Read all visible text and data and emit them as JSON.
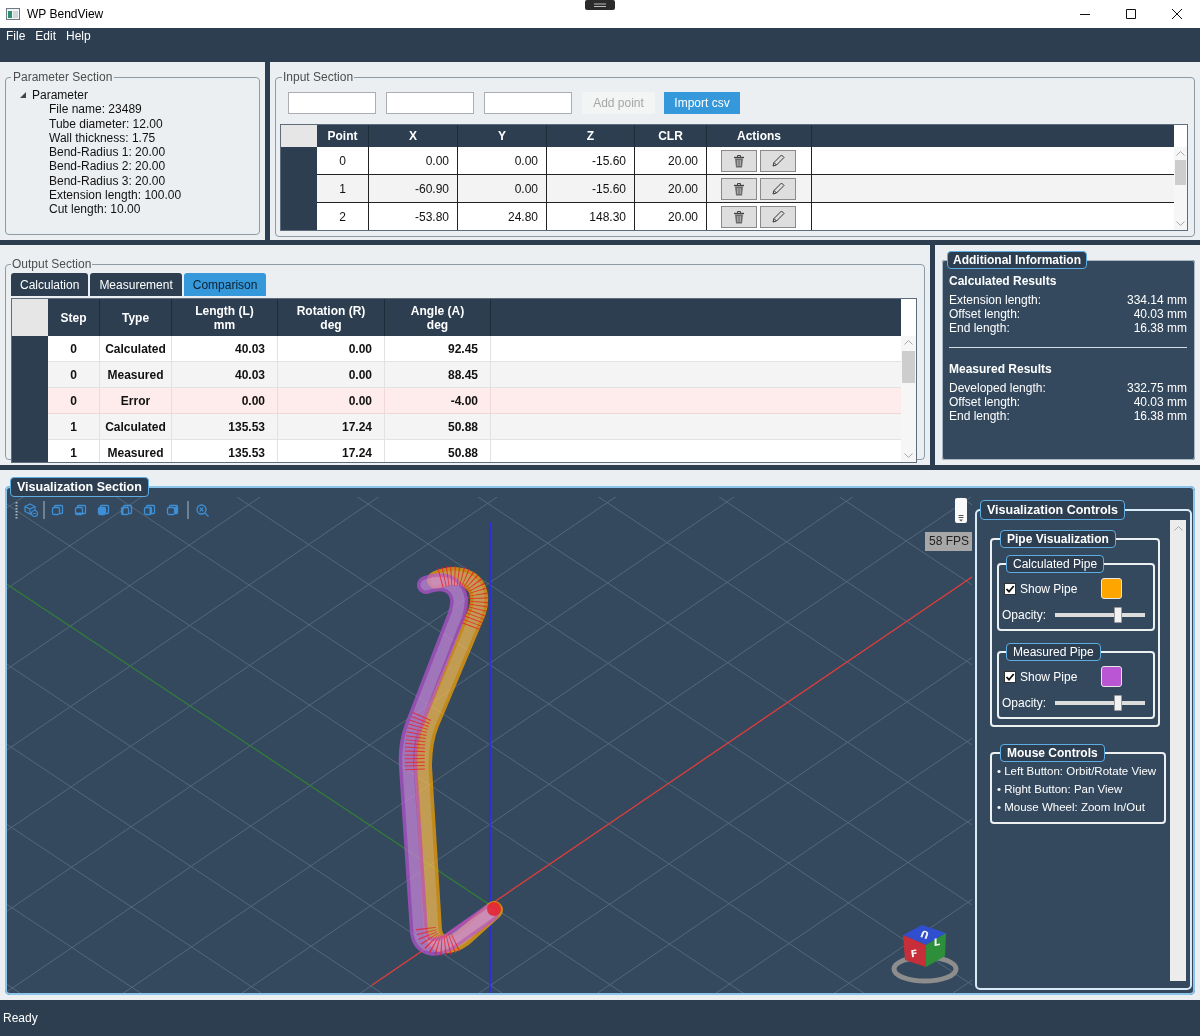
{
  "window": {
    "title": "WP BendView"
  },
  "menu": [
    {
      "label": "File"
    },
    {
      "label": "Edit"
    },
    {
      "label": "Help"
    }
  ],
  "parameter_section": {
    "title": "Parameter Section",
    "tree": [
      {
        "label": "Parameter",
        "expanded": true,
        "children": [
          {
            "label": "File name: 23489"
          },
          {
            "label": "Tube diameter: 12.00"
          },
          {
            "label": "Wall thickness: 1.75"
          },
          {
            "label": "Bend-Radius 1: 20.00"
          },
          {
            "label": "Bend-Radius 2: 20.00"
          },
          {
            "label": "Bend-Radius 3: 20.00"
          },
          {
            "label": "Extension length: 100.00"
          },
          {
            "label": "Cut length: 10.00"
          }
        ]
      }
    ]
  },
  "input_section": {
    "title": "Input Section",
    "fields": [
      {
        "kind": "text"
      },
      {
        "kind": "text"
      },
      {
        "kind": "text"
      }
    ],
    "buttons": [
      {
        "label": "Add point",
        "disabled": true
      },
      {
        "label": "Import csv",
        "disabled": false
      }
    ],
    "table": {
      "columns": [
        {
          "label": "Point"
        },
        {
          "label": "X"
        },
        {
          "label": "Y"
        },
        {
          "label": "Z"
        },
        {
          "label": "CLR"
        },
        {
          "label": "Actions"
        }
      ],
      "rows": [
        {
          "cells": [
            "0",
            "0.00",
            "0.00",
            "-15.60",
            "20.00"
          ],
          "actions": [
            {
              "kind": "delete"
            },
            {
              "kind": "edit"
            }
          ]
        },
        {
          "cells": [
            "1",
            "-60.90",
            "0.00",
            "-15.60",
            "20.00"
          ],
          "actions": [
            {
              "kind": "delete"
            },
            {
              "kind": "edit"
            }
          ]
        },
        {
          "cells": [
            "2",
            "-53.80",
            "24.80",
            "148.30",
            "20.00"
          ],
          "actions": [
            {
              "kind": "delete"
            },
            {
              "kind": "edit"
            }
          ]
        }
      ]
    }
  },
  "output_section": {
    "title": "Output Section",
    "tabs": [
      {
        "label": "Calculation",
        "selected": false
      },
      {
        "label": "Measurement",
        "selected": false
      },
      {
        "label": "Comparison",
        "selected": true
      }
    ],
    "table": {
      "columns": [
        {
          "label": "Step"
        },
        {
          "label": "Type"
        },
        {
          "label": "Length (L)",
          "unit": "mm"
        },
        {
          "label": "Rotation (R)",
          "unit": "deg"
        },
        {
          "label": "Angle (A)",
          "unit": "deg"
        }
      ],
      "rows": [
        {
          "kind": "calculated",
          "cells": [
            "0",
            "Calculated",
            "40.03",
            "0.00",
            "92.45"
          ]
        },
        {
          "kind": "measured",
          "cells": [
            "0",
            "Measured",
            "40.03",
            "0.00",
            "88.45"
          ]
        },
        {
          "kind": "error",
          "cells": [
            "0",
            "Error",
            "0.00",
            "0.00",
            "-4.00"
          ]
        },
        {
          "kind": "calculated",
          "cells": [
            "1",
            "Calculated",
            "135.53",
            "17.24",
            "50.88"
          ]
        },
        {
          "kind": "measured",
          "cells": [
            "1",
            "Measured",
            "135.53",
            "17.24",
            "50.88"
          ]
        }
      ]
    }
  },
  "additional_information": {
    "title": "Additional Information",
    "groups": [
      {
        "heading": "Calculated Results",
        "items": [
          {
            "label": "Extension length:",
            "value": "334.14 mm"
          },
          {
            "label": "Offset length:",
            "value": "40.03 mm"
          },
          {
            "label": "End length:",
            "value": "16.38 mm"
          }
        ]
      },
      {
        "heading": "Measured Results",
        "items": [
          {
            "label": "Developed length:",
            "value": "332.75 mm"
          },
          {
            "label": "Offset length:",
            "value": "40.03 mm"
          },
          {
            "label": "End length:",
            "value": "16.38 mm"
          }
        ]
      }
    ]
  },
  "visualization": {
    "title": "Visualization Section",
    "fps": "58 FPS",
    "view_cube_labels": [
      "U",
      "F",
      "L"
    ],
    "controls": {
      "title": "Visualization Controls",
      "pipe_visualization": {
        "title": "Pipe Visualization",
        "pipes": [
          {
            "title": "Calculated Pipe",
            "show_label": "Show Pipe",
            "checked": true,
            "color": "#ffa500",
            "opacity_label": "Opacity:",
            "level": 0.7
          },
          {
            "title": "Measured Pipe",
            "show_label": "Show Pipe",
            "checked": true,
            "color": "#ba55d3",
            "opacity_label": "Opacity:",
            "level": 0.7
          }
        ]
      },
      "mouse_controls": {
        "title": "Mouse Controls",
        "items": [
          "• Left Button: Orbit/Rotate View",
          "• Right Button: Pan View",
          "• Mouse Wheel: Zoom In/Out"
        ]
      }
    }
  },
  "status_bar": {
    "text": "Ready"
  }
}
